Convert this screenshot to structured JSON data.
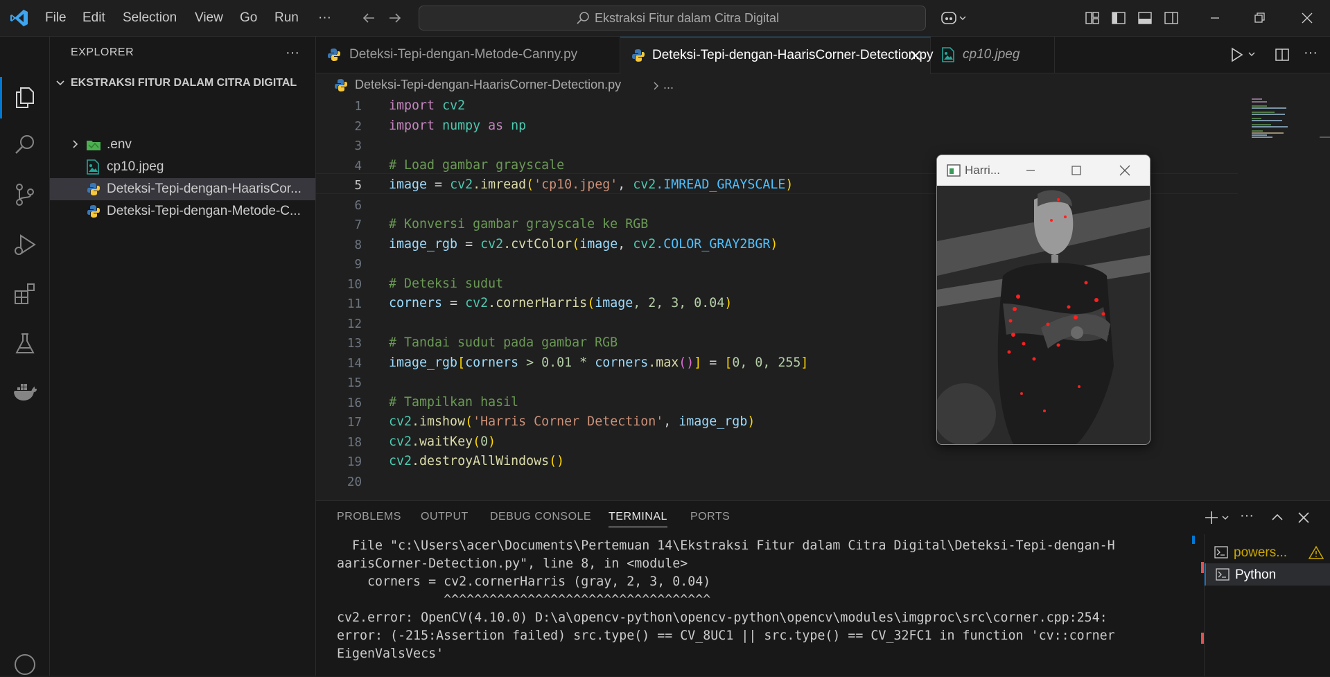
{
  "titlebar": {
    "menu": [
      "File",
      "Edit",
      "Selection",
      "View",
      "Go",
      "Run",
      "···"
    ],
    "search_text": "Ekstraksi Fitur dalam Citra Digital"
  },
  "sidebar": {
    "title": "EXPLORER",
    "more": "···",
    "folder": "EKSTRAKSI FITUR DALAM CITRA DIGITAL",
    "items": [
      {
        "label": ".env"
      },
      {
        "label": "cp10.jpeg"
      },
      {
        "label": "Deteksi-Tepi-dengan-HaarisCor..."
      },
      {
        "label": "Deteksi-Tepi-dengan-Metode-C..."
      }
    ]
  },
  "tabs": [
    {
      "label": "Deteksi-Tepi-dengan-Metode-Canny.py"
    },
    {
      "label": "Deteksi-Tepi-dengan-HaarisCorner-Detection.py"
    },
    {
      "label": "cp10.jpeg"
    }
  ],
  "breadcrumb": {
    "file": "Deteksi-Tepi-dengan-HaarisCorner-Detection.py",
    "rest": "..."
  },
  "editor": {
    "line_numbers": [
      "1",
      "2",
      "3",
      "4",
      "5",
      "6",
      "7",
      "8",
      "9",
      "10",
      "11",
      "12",
      "13",
      "14",
      "15",
      "16",
      "17",
      "18",
      "19",
      "20"
    ],
    "code": {
      "l1_kw": "import",
      "l1_mod": "cv2",
      "l2_kw": "import",
      "l2_mod": "numpy",
      "l2_as": "as",
      "l2_alias": "np",
      "l4": "# Load gambar grayscale",
      "l5_var": "image",
      "l5_eq": " = ",
      "l5_obj": "cv2",
      "l5_fn": ".imread",
      "l5_p1": "(",
      "l5_str": "'cp10.jpeg'",
      "l5_sep": ", ",
      "l5_obj2": "cv2",
      "l5_const": ".IMREAD_GRAYSCALE",
      "l5_p2": ")",
      "l7": "# Konversi gambar grayscale ke RGB",
      "l8_var": "image_rgb",
      "l8_eq": " = ",
      "l8_obj": "cv2",
      "l8_fn": ".cvtColor",
      "l8_p1": "(",
      "l8_arg": "image",
      "l8_sep": ", ",
      "l8_obj2": "cv2",
      "l8_const": ".COLOR_GRAY2BGR",
      "l8_p2": ")",
      "l10": "# Deteksi sudut",
      "l11_var": "corners",
      "l11_eq": " = ",
      "l11_obj": "cv2",
      "l11_fn": ".cornerHarris",
      "l11_p1": "(",
      "l11_arg": "image",
      "l11_rest": ", 2, 3, 0.04",
      "l11_p2": ")",
      "l13": "# Tandai sudut pada gambar RGB",
      "l14_var": "image_rgb",
      "l14_b1": "[",
      "l14_v2": "corners",
      "l14_op": " > 0.01 * ",
      "l14_v3": "corners",
      "l14_fn": ".max",
      "l14_pp": "()",
      "l14_b2": "]",
      "l14_eq": " = ",
      "l14_b3": "[",
      "l14_nums": "0, 0, 255",
      "l14_b4": "]",
      "l16": "# Tampilkan hasil",
      "l17_obj": "cv2",
      "l17_fn": ".imshow",
      "l17_p1": "(",
      "l17_str": "'Harris Corner Detection'",
      "l17_sep": ", ",
      "l17_arg": "image_rgb",
      "l17_p2": ")",
      "l18_obj": "cv2",
      "l18_fn": ".waitKey",
      "l18_p1": "(",
      "l18_num": "0",
      "l18_p2": ")",
      "l19_obj": "cv2",
      "l19_fn": ".destroyAllWindows",
      "l19_pp": "()"
    }
  },
  "cv_window": {
    "title": "Harri..."
  },
  "panel": {
    "tabs": [
      "PROBLEMS",
      "OUTPUT",
      "DEBUG CONSOLE",
      "TERMINAL",
      "PORTS"
    ],
    "terminal_lines": [
      "  File \"c:\\Users\\acer\\Documents\\Pertemuan 14\\Ekstraksi Fitur dalam Citra Digital\\Deteksi-Tepi-dengan-H",
      "aarisCorner-Detection.py\", line 8, in <module>",
      "    corners = cv2.cornerHarris (gray, 2, 3, 0.04)",
      "              ^^^^^^^^^^^^^^^^^^^^^^^^^^^^^^^^^^^",
      "cv2.error: OpenCV(4.10.0) D:\\a\\opencv-python\\opencv-python\\opencv\\modules\\imgproc\\src\\corner.cpp:254:",
      "error: (-215:Assertion failed) src.type() == CV_8UC1 || src.type() == CV_32FC1 in function 'cv::corner",
      "EigenValsVecs'"
    ],
    "terminals": [
      {
        "label": "powers..."
      },
      {
        "label": "Python"
      }
    ]
  }
}
